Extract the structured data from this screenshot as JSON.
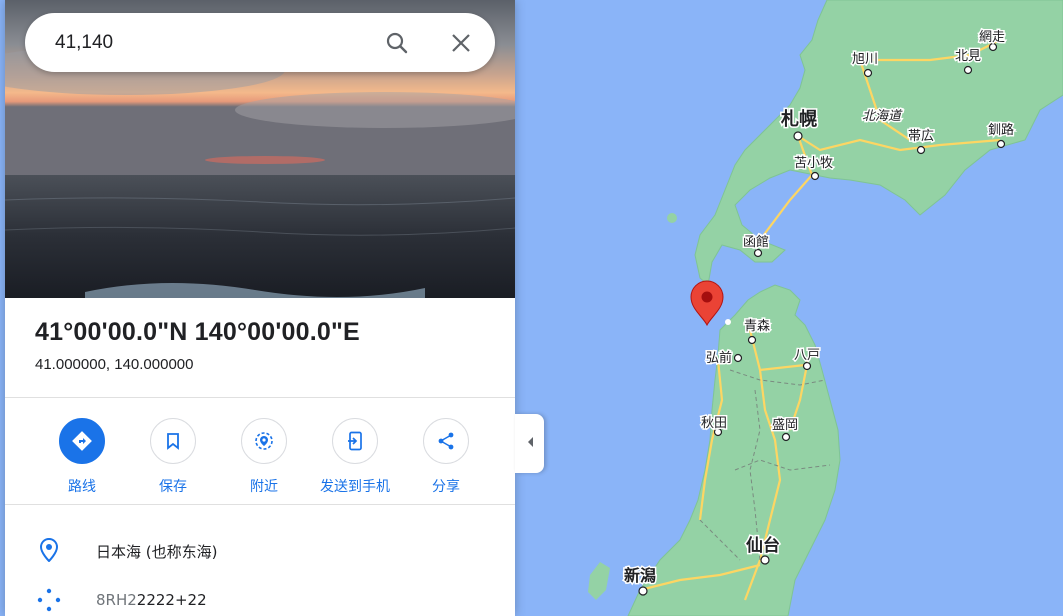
{
  "search": {
    "value": "41,140",
    "icon_search": "search-icon",
    "icon_clear": "close-icon"
  },
  "place": {
    "title": "41°00'00.0\"N 140°00'00.0\"E",
    "decimal": "41.000000, 140.000000"
  },
  "actions": [
    {
      "label": "路线",
      "icon": "directions-icon"
    },
    {
      "label": "保存",
      "icon": "bookmark-icon"
    },
    {
      "label": "附近",
      "icon": "nearby-icon"
    },
    {
      "label": "发送到手机",
      "icon": "send-to-phone-icon"
    },
    {
      "label": "分享",
      "icon": "share-icon"
    }
  ],
  "info": {
    "place_name": "日本海 (也称东海)",
    "plus_code_prefix": "8RH2",
    "plus_code_main": "2222+22"
  },
  "map": {
    "cities": [
      {
        "name": "網走",
        "size": "small"
      },
      {
        "name": "旭川",
        "size": "small"
      },
      {
        "name": "北見",
        "size": "small"
      },
      {
        "name": "札幌",
        "size": "large"
      },
      {
        "name": "北海道",
        "size": "region"
      },
      {
        "name": "帯広",
        "size": "small"
      },
      {
        "name": "釧路",
        "size": "small"
      },
      {
        "name": "苫小牧",
        "size": "small"
      },
      {
        "name": "函館",
        "size": "small"
      },
      {
        "name": "青森",
        "size": "small"
      },
      {
        "name": "弘前",
        "size": "small"
      },
      {
        "name": "八戸",
        "size": "small"
      },
      {
        "name": "秋田",
        "size": "small"
      },
      {
        "name": "盛岡",
        "size": "small"
      },
      {
        "name": "仙台",
        "size": "large"
      },
      {
        "name": "新潟",
        "size": "large"
      }
    ],
    "marker_icon": "map-pin-icon"
  },
  "colors": {
    "accent": "#1a73e8",
    "water": "#8ab4f8",
    "land": "#94d2a5",
    "road": "#fdd663",
    "marker": "#ea4335"
  },
  "collapse_icon": "chevron-left-icon"
}
